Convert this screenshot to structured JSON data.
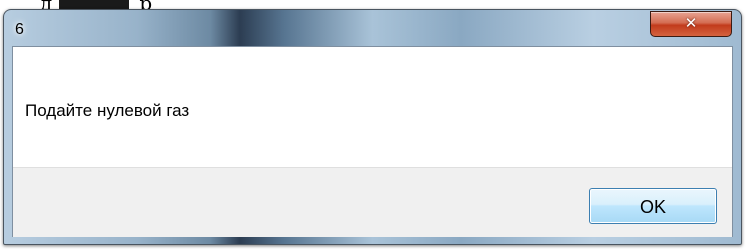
{
  "dialog": {
    "title": "6",
    "message": "Подайте нулевой газ",
    "close_icon": "close-icon",
    "ok_label": "OK"
  },
  "background_document": {
    "fragment_left": "д",
    "fragment_right": "р"
  },
  "colors": {
    "close_button": "#c7472a",
    "ok_button_border": "#3c7fb1",
    "button_area": "#f0f0f0"
  }
}
